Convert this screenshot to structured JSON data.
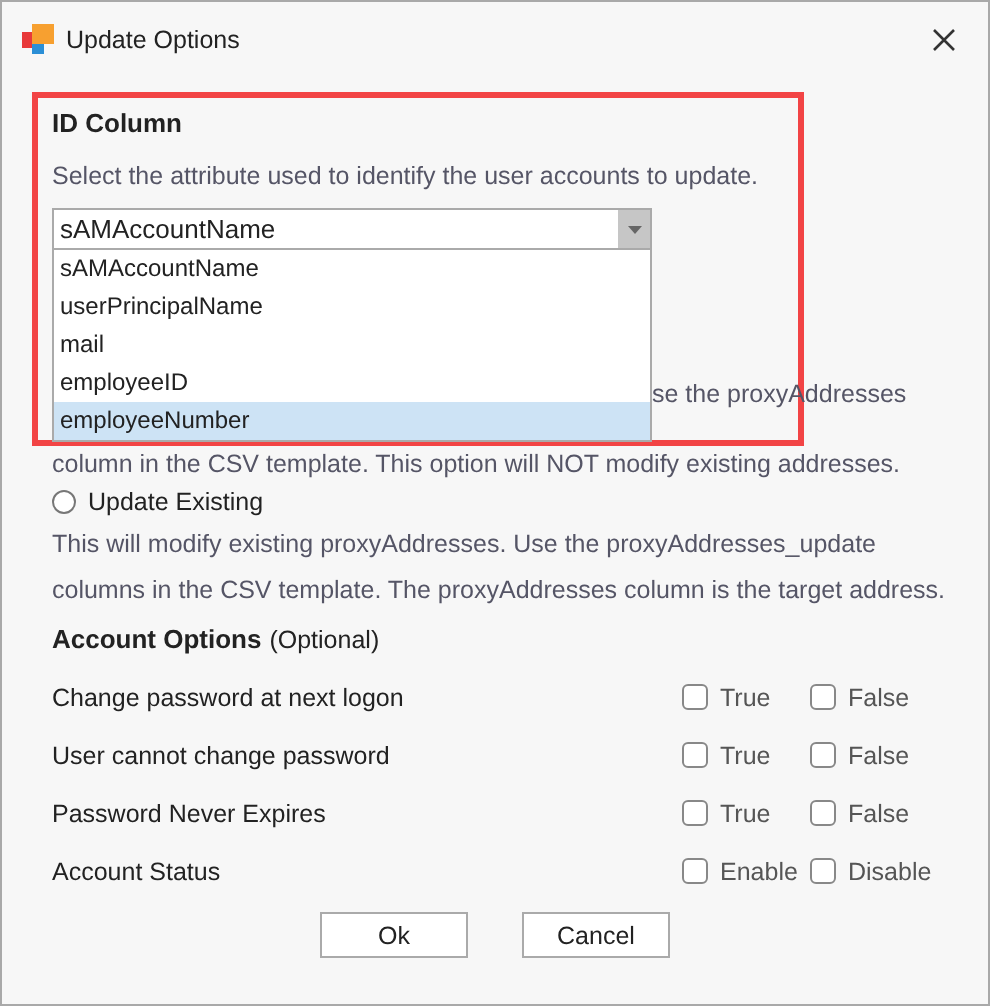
{
  "window": {
    "title": "Update Options"
  },
  "id_column": {
    "heading": "ID Column",
    "description": "Select the attribute used to identify the user accounts to update.",
    "combo_value": "sAMAccountName",
    "dropdown_open": true,
    "options": [
      {
        "label": "sAMAccountName",
        "selected": false
      },
      {
        "label": "userPrincipalName",
        "selected": false
      },
      {
        "label": "mail",
        "selected": false
      },
      {
        "label": "employeeID",
        "selected": false
      },
      {
        "label": "employeeNumber",
        "selected": true
      }
    ]
  },
  "partial_text": [
    "se the proxyAddresses",
    "column in the CSV template. This option will NOT modify existing addresses."
  ],
  "update_existing": {
    "label": "Update Existing",
    "selected": false,
    "description": [
      "This will modify existing proxyAddresses. Use the proxyAddresses_update",
      "columns in the CSV template. The proxyAddresses column is the target address."
    ]
  },
  "account_options": {
    "heading": "Account Options",
    "note": "(Optional)",
    "rows": [
      {
        "label": "Change password at next logon",
        "choices": [
          {
            "label": "True",
            "checked": false
          },
          {
            "label": "False",
            "checked": false
          }
        ]
      },
      {
        "label": "User cannot change password",
        "choices": [
          {
            "label": "True",
            "checked": false
          },
          {
            "label": "False",
            "checked": false
          }
        ]
      },
      {
        "label": "Password Never Expires",
        "choices": [
          {
            "label": "True",
            "checked": false
          },
          {
            "label": "False",
            "checked": false
          }
        ]
      },
      {
        "label": "Account Status",
        "choices": [
          {
            "label": "Enable",
            "checked": false
          },
          {
            "label": "Disable",
            "checked": false
          }
        ]
      }
    ]
  },
  "buttons": [
    "Ok",
    "Cancel"
  ]
}
